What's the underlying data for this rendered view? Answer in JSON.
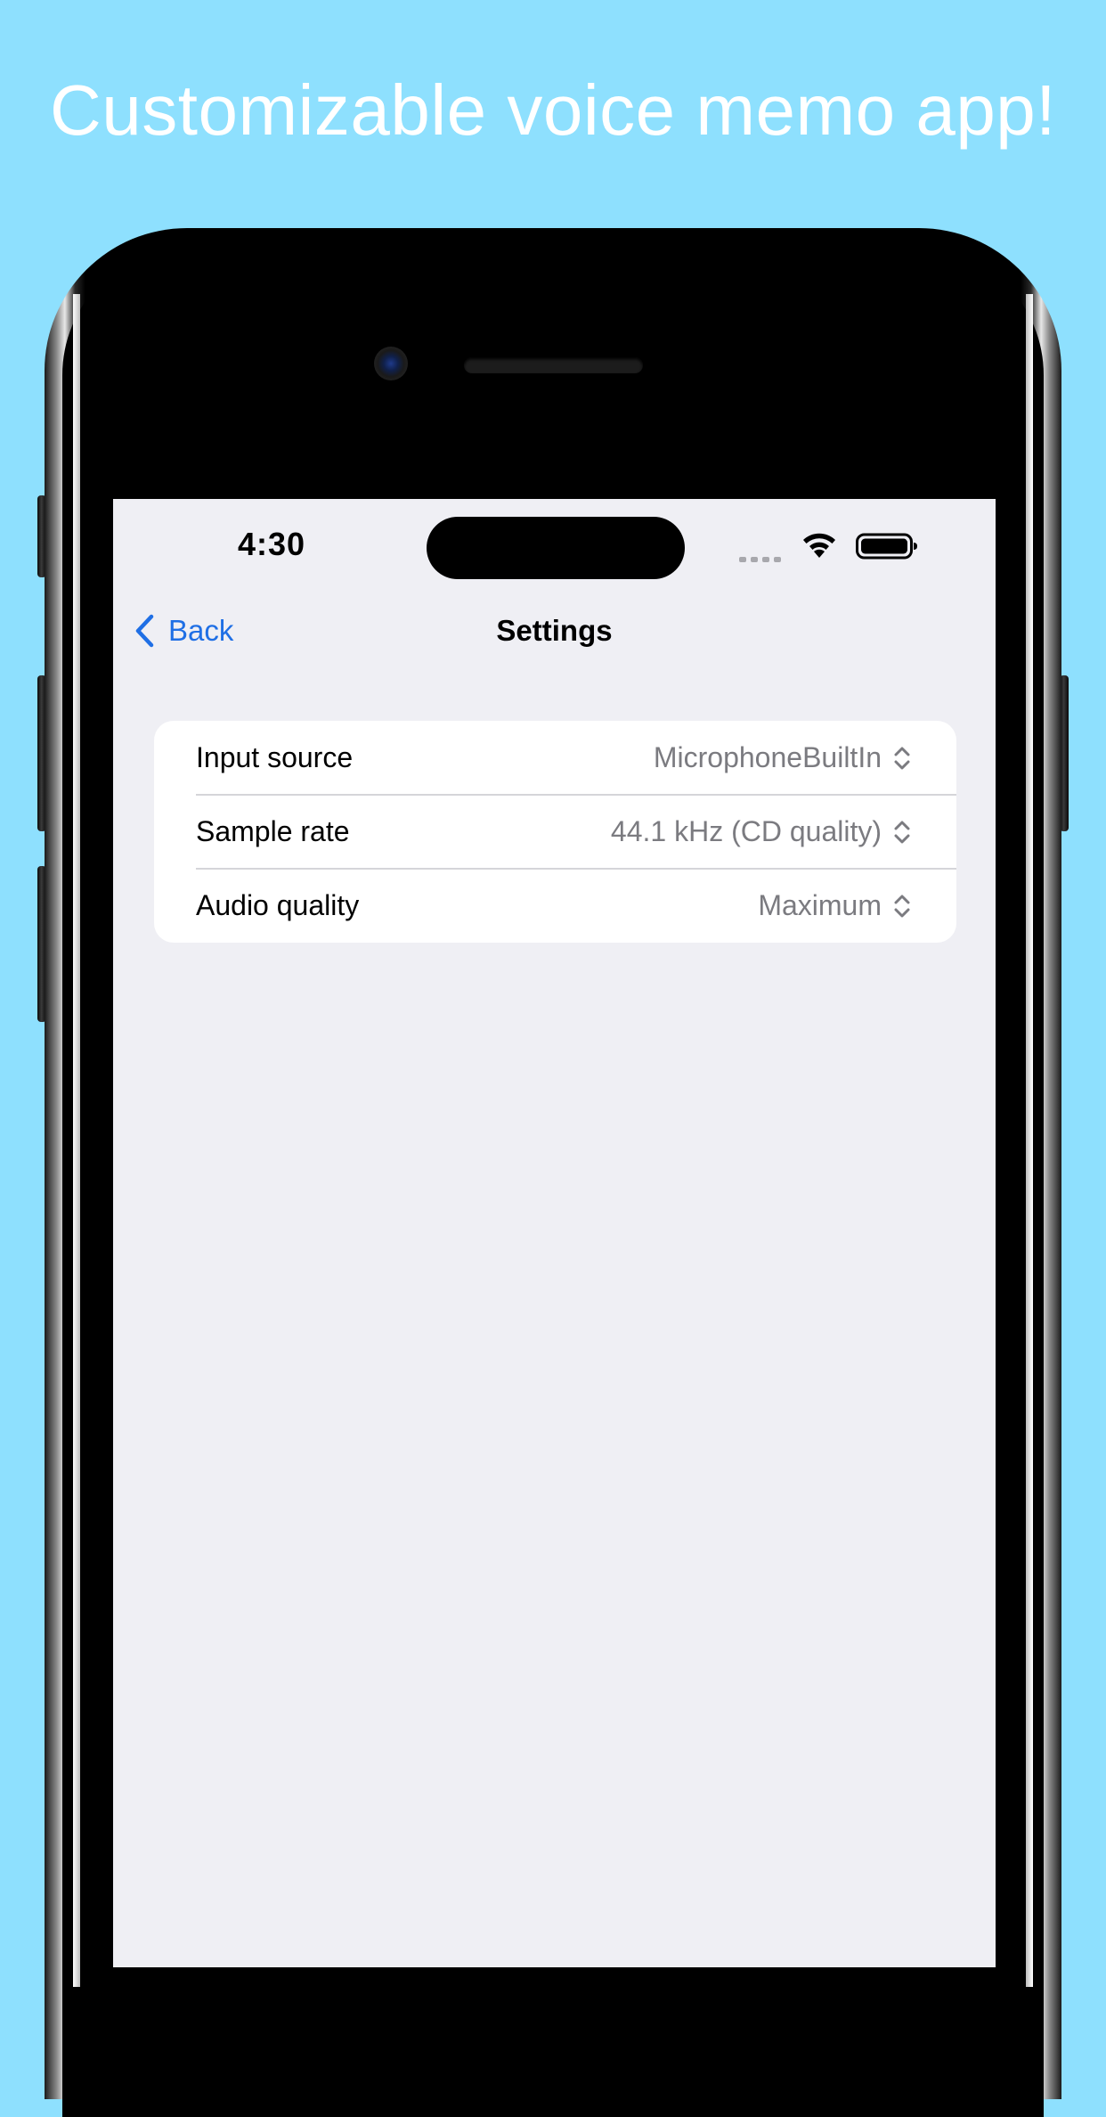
{
  "headline": "Customizable voice memo app!",
  "status_bar": {
    "time": "4:30",
    "icons": [
      "cellular-signal-icon",
      "wifi-icon",
      "battery-icon"
    ]
  },
  "nav": {
    "back_label": "Back",
    "title": "Settings"
  },
  "settings": {
    "rows": [
      {
        "label": "Input source",
        "value": "MicrophoneBuiltIn"
      },
      {
        "label": "Sample rate",
        "value": "44.1 kHz (CD quality)"
      },
      {
        "label": "Audio quality",
        "value": "Maximum"
      }
    ]
  },
  "colors": {
    "background": "#8EE0FE",
    "screen": "#EFEFF4",
    "accent": "#1F6FE5",
    "secondary_text": "#7B7B80"
  }
}
